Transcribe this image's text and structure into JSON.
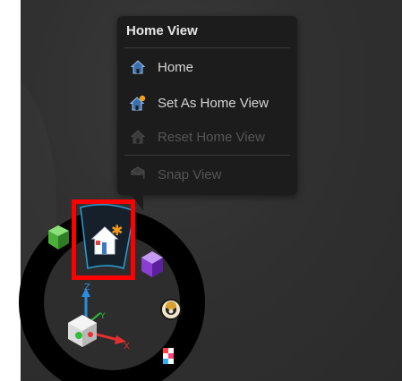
{
  "flyout": {
    "title": "Home View",
    "items": [
      {
        "label": "Home",
        "icon": "home-icon",
        "enabled": true
      },
      {
        "label": "Set As Home View",
        "icon": "set-home-icon",
        "enabled": true
      },
      {
        "label": "Reset Home View",
        "icon": "reset-home-icon",
        "enabled": false
      },
      {
        "label": "Snap View",
        "icon": "snap-view-icon",
        "enabled": false
      }
    ]
  },
  "wheel": {
    "tools": [
      "cube-icon",
      "home-view-icon",
      "view-cube-icon",
      "steering-wheel-icon",
      "checker-icon"
    ],
    "selected": "home-view-icon"
  },
  "triad": {
    "x_label": "X",
    "y_label": "Y",
    "z_label": "Z"
  },
  "colors": {
    "highlight": "#ff0000",
    "accent": "#2a9fd6",
    "axis_x": "#e53030",
    "axis_y": "#2fbf3a",
    "axis_z": "#2a8ee0"
  }
}
